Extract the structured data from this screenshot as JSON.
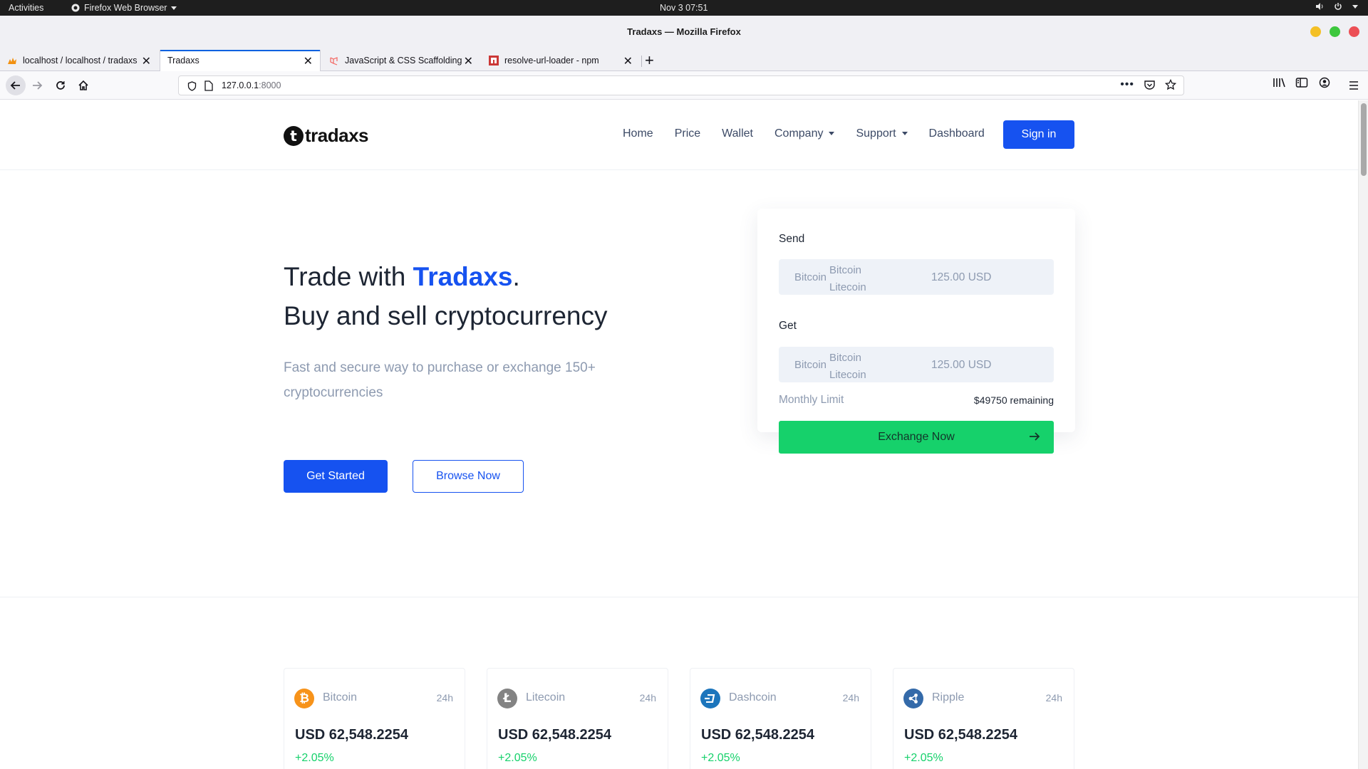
{
  "os_bar": {
    "activities": "Activities",
    "app_menu": "Firefox Web Browser",
    "clock": "Nov 3  07:51"
  },
  "window": {
    "title": "Tradaxs — Mozilla Firefox"
  },
  "tabs": [
    {
      "label": "localhost / localhost / tradaxs",
      "active": false
    },
    {
      "label": "Tradaxs",
      "active": true
    },
    {
      "label": "JavaScript & CSS Scaffolding",
      "active": false
    },
    {
      "label": "resolve-url-loader - npm",
      "active": false
    }
  ],
  "urlbar": {
    "host": "127.0.0.1",
    "port": ":8000"
  },
  "site": {
    "logo_mark": "t",
    "logo_text": "tradaxs",
    "menu": {
      "home": "Home",
      "price": "Price",
      "wallet": "Wallet",
      "company": "Company",
      "support": "Support",
      "dashboard": "Dashboard"
    },
    "signin": "Sign in"
  },
  "hero": {
    "line1_prefix": "Trade with ",
    "line1_brand": "Tradaxs",
    "line1_suffix": ".",
    "line2": "Buy and sell cryptocurrency",
    "subtitle": "Fast and secure way to purchase or exchange 150+ cryptocurrencies",
    "primary_button": "Get Started",
    "secondary_button": "Browse Now"
  },
  "exchange": {
    "send_label": "Send",
    "get_label": "Get",
    "send": {
      "selected": "Bitcoin",
      "options": [
        "Bitcoin",
        "Litecoin"
      ],
      "amount": "125.00 USD"
    },
    "get": {
      "selected": "Bitcoin",
      "options": [
        "Bitcoin",
        "Litecoin"
      ],
      "amount": "125.00 USD"
    },
    "limit_label": "Monthly Limit",
    "limit_value": "$49750 remaining",
    "button": "Exchange Now"
  },
  "coins": [
    {
      "name": "Bitcoin",
      "period": "24h",
      "price": "USD 62,548.2254",
      "change": "+2.05%",
      "color": "#f7931a",
      "icon": "bitcoin-icon"
    },
    {
      "name": "Litecoin",
      "period": "24h",
      "price": "USD 62,548.2254",
      "change": "+2.05%",
      "color": "#838383",
      "icon": "litecoin-icon"
    },
    {
      "name": "Dashcoin",
      "period": "24h",
      "price": "USD 62,548.2254",
      "change": "+2.05%",
      "color": "#1c75bc",
      "icon": "dash-icon"
    },
    {
      "name": "Ripple",
      "period": "24h",
      "price": "USD 62,548.2254",
      "change": "+2.05%",
      "color": "#346aa9",
      "icon": "ripple-icon"
    }
  ],
  "colors": {
    "brand_blue": "#1652f0",
    "success_green": "#16d16b",
    "muted_text": "#8d9ab0"
  }
}
